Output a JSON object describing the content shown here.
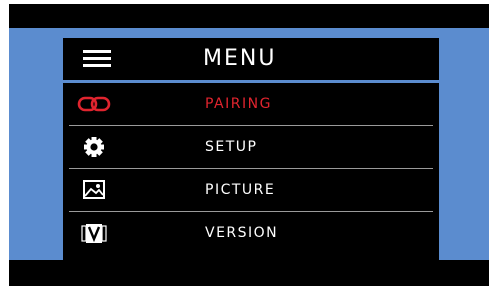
{
  "menu": {
    "title": "MENU",
    "items": [
      {
        "label": "PAIRING",
        "icon": "link-icon",
        "active": true
      },
      {
        "label": "SETUP",
        "icon": "gear-icon",
        "active": false
      },
      {
        "label": "PICTURE",
        "icon": "picture-icon",
        "active": false
      },
      {
        "label": "VERSION",
        "icon": "version-icon",
        "active": false
      }
    ]
  },
  "colors": {
    "background": "#5b8ccf",
    "panel": "#000000",
    "accent": "#e0242e",
    "text": "#ffffff",
    "divider": "#9a9a9a"
  }
}
